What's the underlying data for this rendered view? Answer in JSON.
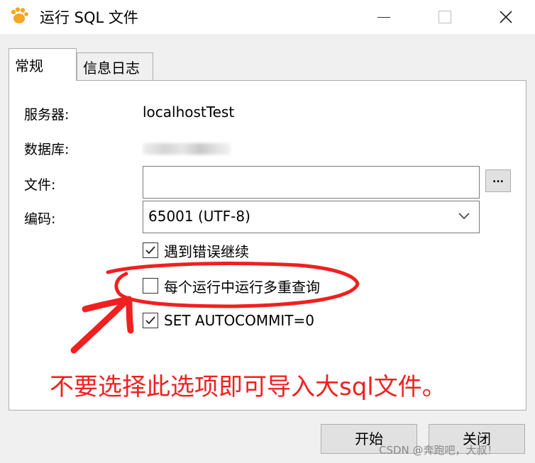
{
  "window": {
    "title": "运行 SQL 文件",
    "app_icon": "paw-icon",
    "controls": [
      "minimize-icon",
      "maximize-icon",
      "close-icon"
    ]
  },
  "tabs": [
    {
      "label": "常规",
      "active": true
    },
    {
      "label": "信息日志",
      "active": false
    }
  ],
  "form": {
    "server_label": "服务器:",
    "server_value": "localhostTest",
    "database_label": "数据库:",
    "file_label": "文件:",
    "file_value": "",
    "browse_label": "...",
    "encoding_label": "编码:",
    "encoding_value": "65001 (UTF-8)"
  },
  "options": [
    {
      "label": "遇到错误继续",
      "checked": true
    },
    {
      "label": "每个运行中运行多重查询",
      "checked": false
    },
    {
      "label": "SET AUTOCOMMIT=0",
      "checked": true
    }
  ],
  "annotation": {
    "text": "不要选择此选项即可导入大sql文件。",
    "color": "#f02020"
  },
  "buttons": {
    "start": "开始",
    "close": "关闭"
  },
  "watermark": "CSDN @奔跑吧，大叔！",
  "colors": {
    "icon_orange": "#f5a623",
    "red_marker": "#f02020"
  }
}
